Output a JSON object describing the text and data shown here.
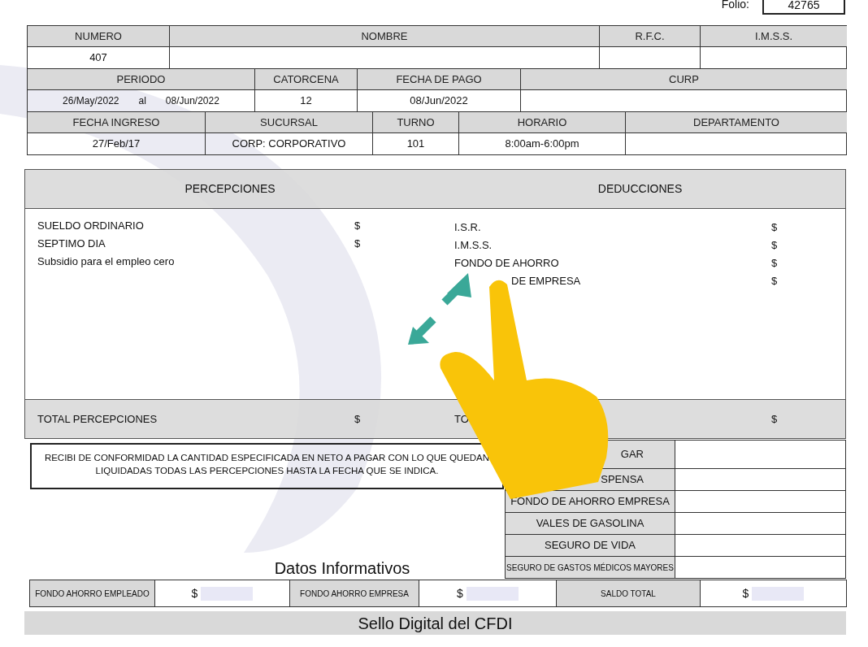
{
  "folio": {
    "label": "Folio:",
    "value": "42765"
  },
  "employee_groups": [
    {
      "cells": [
        {
          "heading": "NUMERO",
          "values": [
            "407"
          ]
        },
        {
          "heading": "NOMBRE"
        },
        {
          "heading": "R.F.C."
        },
        {
          "heading": "I.M.S.S."
        }
      ]
    },
    {
      "cells": [
        {
          "heading": "PERIODO",
          "values": [
            "26/May/2022",
            "al",
            "08/Jun/2022"
          ]
        },
        {
          "heading": "CATORCENA",
          "values": [
            "12"
          ]
        },
        {
          "heading": "FECHA DE PAGO",
          "values": [
            "08/Jun/2022"
          ]
        },
        {
          "heading": "CURP"
        }
      ]
    },
    {
      "cells": [
        {
          "heading": "FECHA INGRESO",
          "values": [
            "27/Feb/17"
          ]
        },
        {
          "heading": "SUCURSAL",
          "values": [
            "CORP: CORPORATIVO"
          ]
        },
        {
          "heading": "TURNO",
          "values": [
            "101"
          ]
        },
        {
          "heading": "HORARIO",
          "values": [
            "8:00am-6:00pm"
          ]
        },
        {
          "heading": "DEPARTAMENTO"
        }
      ]
    }
  ],
  "percepciones": {
    "heading": "PERCEPCIONES",
    "items": [
      {
        "label": "SUELDO ORDINARIO",
        "currency": "$"
      },
      {
        "label": "SEPTIMO DIA",
        "currency": "$"
      },
      {
        "label": "Subsidio para el empleo cero"
      }
    ],
    "total": {
      "label": "TOTAL PERCEPCIONES",
      "currency": "$"
    }
  },
  "deducciones": {
    "heading": "DEDUCCIONES",
    "items": [
      {
        "label": "I.S.R.",
        "currency": "$",
        "kind": "plain"
      },
      {
        "label": "I.M.S.S.",
        "currency": "$",
        "kind": "plain"
      },
      {
        "label": "FONDO DE AHORRO",
        "currency": "$",
        "kind": "plain"
      },
      {
        "label": "DE EMPRESA",
        "currency": "$",
        "kind": "partly_hidden"
      }
    ],
    "total": {
      "label": "TO",
      "currency": "$"
    }
  },
  "receipt": "RECIBI DE CONFORMIDAD LA CANTIDAD ESPECIFICADA EN NETO A PAGAR CON LO QUE QUEDAN LIQUIDADAS TODAS LAS PERCEPCIONES HASTA LA FECHA QUE SE INDICA.",
  "summary_rows": [
    {
      "label": "GAR",
      "kind": "normal"
    },
    {
      "label": "SPENSA",
      "kind": "normal"
    },
    {
      "label": "FONDO DE AHORRO EMPRESA",
      "kind": "normal"
    },
    {
      "label": "VALES DE GASOLINA",
      "kind": "normal"
    },
    {
      "label": "SEGURO DE VIDA",
      "kind": "normal"
    },
    {
      "label": "SEGURO DE GASTOS MÉDICOS MAYORES",
      "kind": "small"
    }
  ],
  "informative": {
    "title": "Datos Informativos",
    "cells": [
      {
        "label": "FONDO AHORRO EMPLEADO",
        "currency": "$"
      },
      {
        "label": "FONDO AHORRO EMPRESA",
        "currency": "$"
      },
      {
        "label": "SALDO TOTAL",
        "currency": "$"
      }
    ]
  },
  "seal": "Sello Digital del CFDI"
}
